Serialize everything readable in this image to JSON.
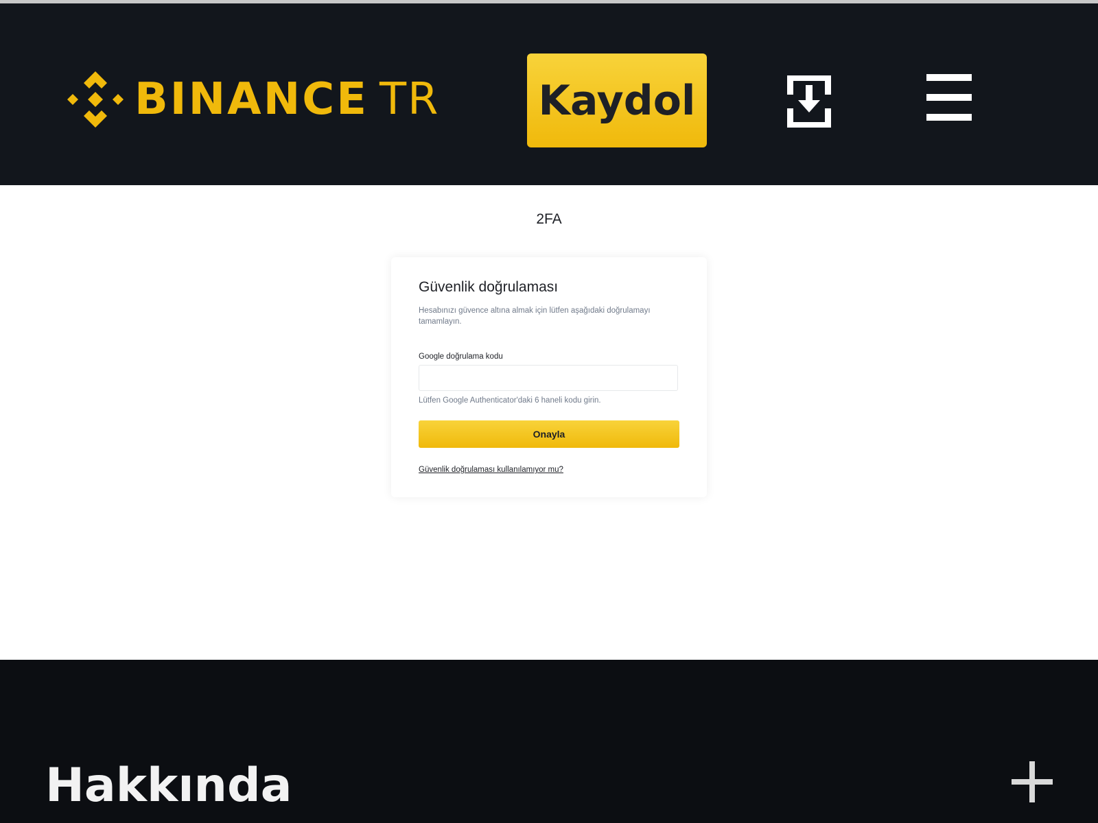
{
  "header": {
    "logo_text": "BINANCE",
    "logo_suffix": "TR",
    "signup_label": "Kaydol",
    "brand_color": "#f0b90b",
    "background": "#12161c",
    "icons": [
      "binance-logo-icon",
      "download-icon",
      "menu-icon"
    ]
  },
  "page": {
    "title": "2FA"
  },
  "card": {
    "title": "Güvenlik doğrulaması",
    "description": "Hesabınızı güvence altına almak için lütfen aşağıdaki doğrulamayı tamamlayın.",
    "field_label": "Google doğrulama kodu",
    "input_value": "",
    "hint": "Lütfen Google Authenticator'daki 6 haneli kodu girin.",
    "confirm_label": "Onayla",
    "help_link": "Güvenlik doğrulaması kullanılamıyor mu?"
  },
  "footer": {
    "title": "Hakkında",
    "expand_icon": "plus-icon"
  }
}
